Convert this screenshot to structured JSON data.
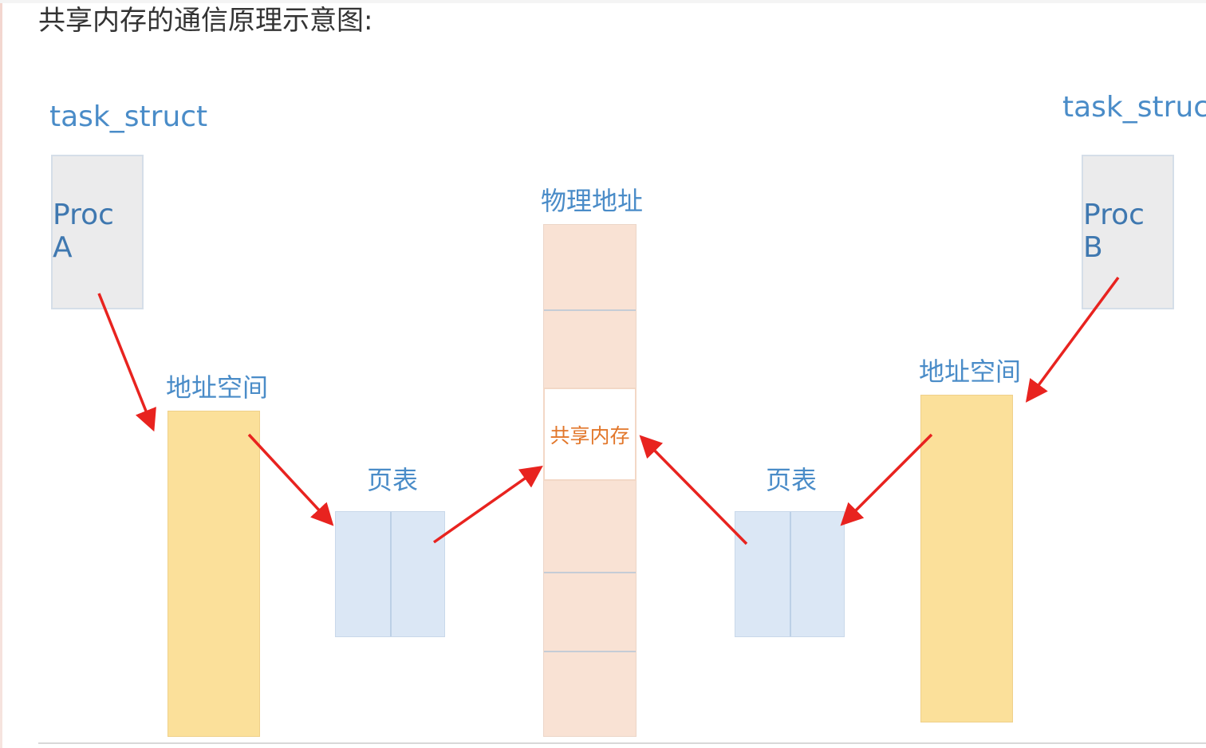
{
  "heading": "共享内存的通信原理示意图:",
  "left": {
    "task_label": "task_struct",
    "proc_label": "Proc A",
    "addr_label": "地址空间",
    "pt_label": "页表"
  },
  "center": {
    "phys_label": "物理地址",
    "shm_label": "共享内存"
  },
  "right": {
    "task_label": "task_struct",
    "proc_label": "Proc B",
    "addr_label": "地址空间",
    "pt_label": "页表"
  },
  "colors": {
    "label_blue": "#4a8cc8",
    "proc_fill": "#ebebec",
    "addr_fill": "#fbe09a",
    "pagetable_fill": "#dbe7f5",
    "phys_fill": "#f9e2d4",
    "shm_text": "#e2772b",
    "arrow": "#e8231f"
  },
  "arrows": [
    {
      "from": "Proc A",
      "to": "地址空间 (left)"
    },
    {
      "from": "地址空间 (left)",
      "to": "页表 (left)"
    },
    {
      "from": "页表 (left)",
      "to": "共享内存"
    },
    {
      "from": "Proc B",
      "to": "地址空间 (right)"
    },
    {
      "from": "地址空间 (right)",
      "to": "页表 (right)"
    },
    {
      "from": "页表 (right)",
      "to": "共享内存"
    }
  ]
}
